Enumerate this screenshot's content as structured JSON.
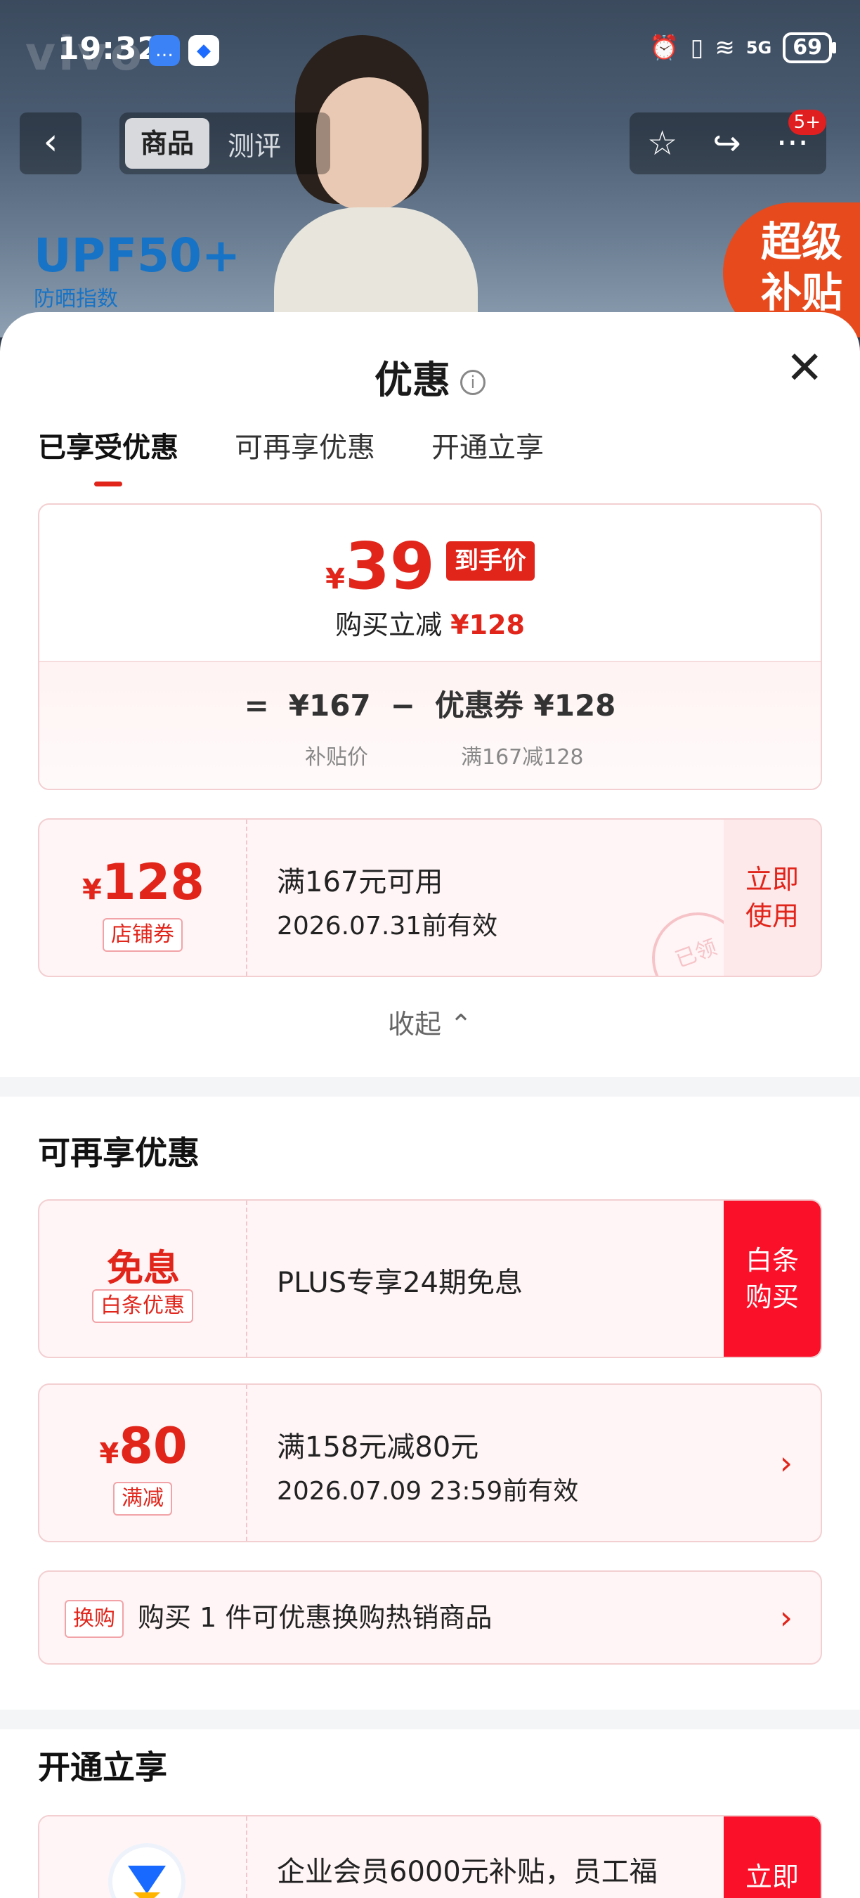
{
  "status_bar": {
    "time": "19:32",
    "signal": "5G",
    "battery": "69"
  },
  "hero": {
    "watermark": "vivo",
    "tabs": [
      "商品",
      "测评"
    ],
    "badge": "5+",
    "upf_title": "UPF50+",
    "upf_sub": "防晒指数",
    "super_badge": [
      "超级",
      "补贴"
    ]
  },
  "sheet": {
    "title": "优惠",
    "tabs": [
      "已享受优惠",
      "可再享优惠",
      "开通立享"
    ],
    "final_price": {
      "yen": "¥",
      "value": "39",
      "tag": "到手价"
    },
    "reduce_label": "购买立减",
    "reduce_value": "¥128",
    "calc": {
      "equals": "=",
      "subsidy_price": "¥167",
      "minus": "−",
      "coupon": "优惠券 ¥128",
      "subsidy_label": "补贴价",
      "coupon_rule": "满167减128"
    },
    "applied_coupon": {
      "yen": "¥",
      "amount": "128",
      "tag": "店铺券",
      "title": "满167元可用",
      "valid": "2026.07.31前有效",
      "action": "立即\n使用",
      "stamp": "已领"
    },
    "collapse": "收起 ⌃",
    "more_title": "可再享优惠",
    "baitiao": {
      "amount": "免息",
      "tag": "白条优惠",
      "title": "PLUS专享24期免息",
      "action": "白条\n购买"
    },
    "full_reduce": {
      "yen": "¥",
      "amount": "80",
      "tag": "满减",
      "title": "满158元减80元",
      "valid": "2026.07.09 23:59前有效"
    },
    "swap": {
      "tag": "换购",
      "text": "购买 1 件可优惠换购热销商品"
    },
    "open_title": "开通立享",
    "enterprise": {
      "title": "企业会员6000元补贴，员工福",
      "action": "立即"
    }
  },
  "colors": {
    "accent": "#e1251b",
    "button": "#fa1028",
    "upf": "#1773c6"
  }
}
